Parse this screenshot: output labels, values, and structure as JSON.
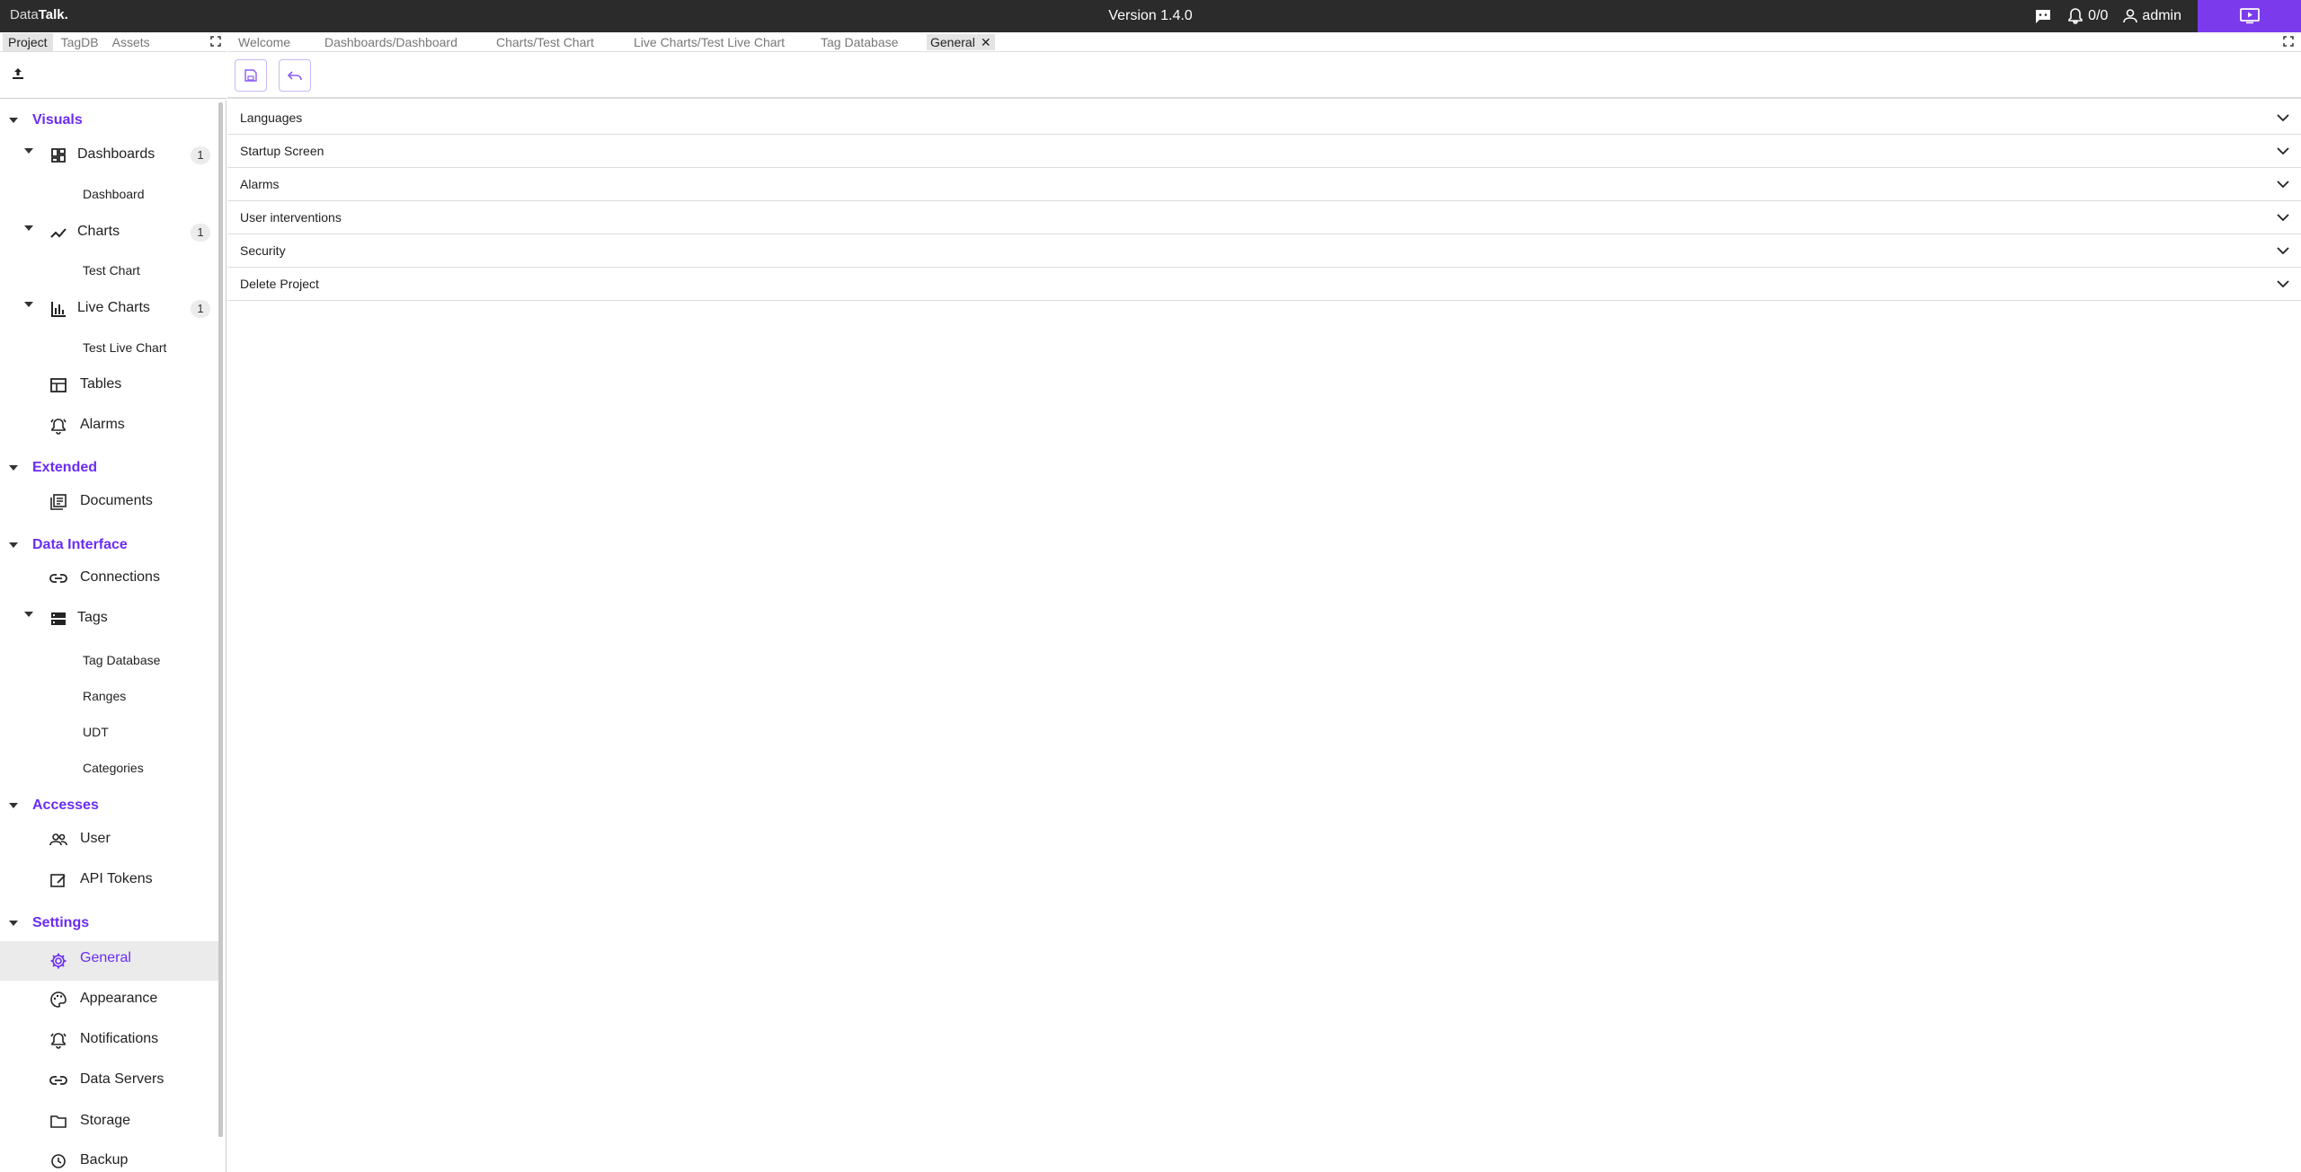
{
  "topbar": {
    "brand_prefix": "Data",
    "brand_bold": "Talk.",
    "version": "Version 1.4.0",
    "alarm_count": "0/0",
    "user": "admin"
  },
  "left_tabs": [
    "Project",
    "TagDB",
    "Assets"
  ],
  "sidebar": {
    "visuals": "Visuals",
    "dashboards": "Dashboards",
    "dashboards_count": "1",
    "dashboard": "Dashboard",
    "charts": "Charts",
    "charts_count": "1",
    "test_chart": "Test Chart",
    "live_charts": "Live Charts",
    "live_charts_count": "1",
    "test_live_chart": "Test Live Chart",
    "tables": "Tables",
    "alarms": "Alarms",
    "extended": "Extended",
    "documents": "Documents",
    "data_interface": "Data Interface",
    "connections": "Connections",
    "tags": "Tags",
    "tag_database": "Tag Database",
    "ranges": "Ranges",
    "udt": "UDT",
    "categories": "Categories",
    "accesses": "Accesses",
    "user": "User",
    "api_tokens": "API Tokens",
    "settings": "Settings",
    "general": "General",
    "appearance": "Appearance",
    "notifications": "Notifications",
    "data_servers": "Data Servers",
    "storage": "Storage",
    "backup": "Backup"
  },
  "main_tabs": {
    "welcome": "Welcome",
    "dashboard": "Dashboards/Dashboard",
    "chart": "Charts/Test Chart",
    "live_chart": "Live Charts/Test Live Chart",
    "tag_db": "Tag Database",
    "general": "General"
  },
  "sections": {
    "languages": "Languages",
    "startup": "Startup Screen",
    "alarms": "Alarms",
    "user_interventions": "User interventions",
    "security": "Security",
    "delete_project": "Delete Project"
  },
  "colors": {
    "accent": "#6b2cf5",
    "topbar": "#2b2b2b",
    "display_button": "#7c3aed"
  }
}
